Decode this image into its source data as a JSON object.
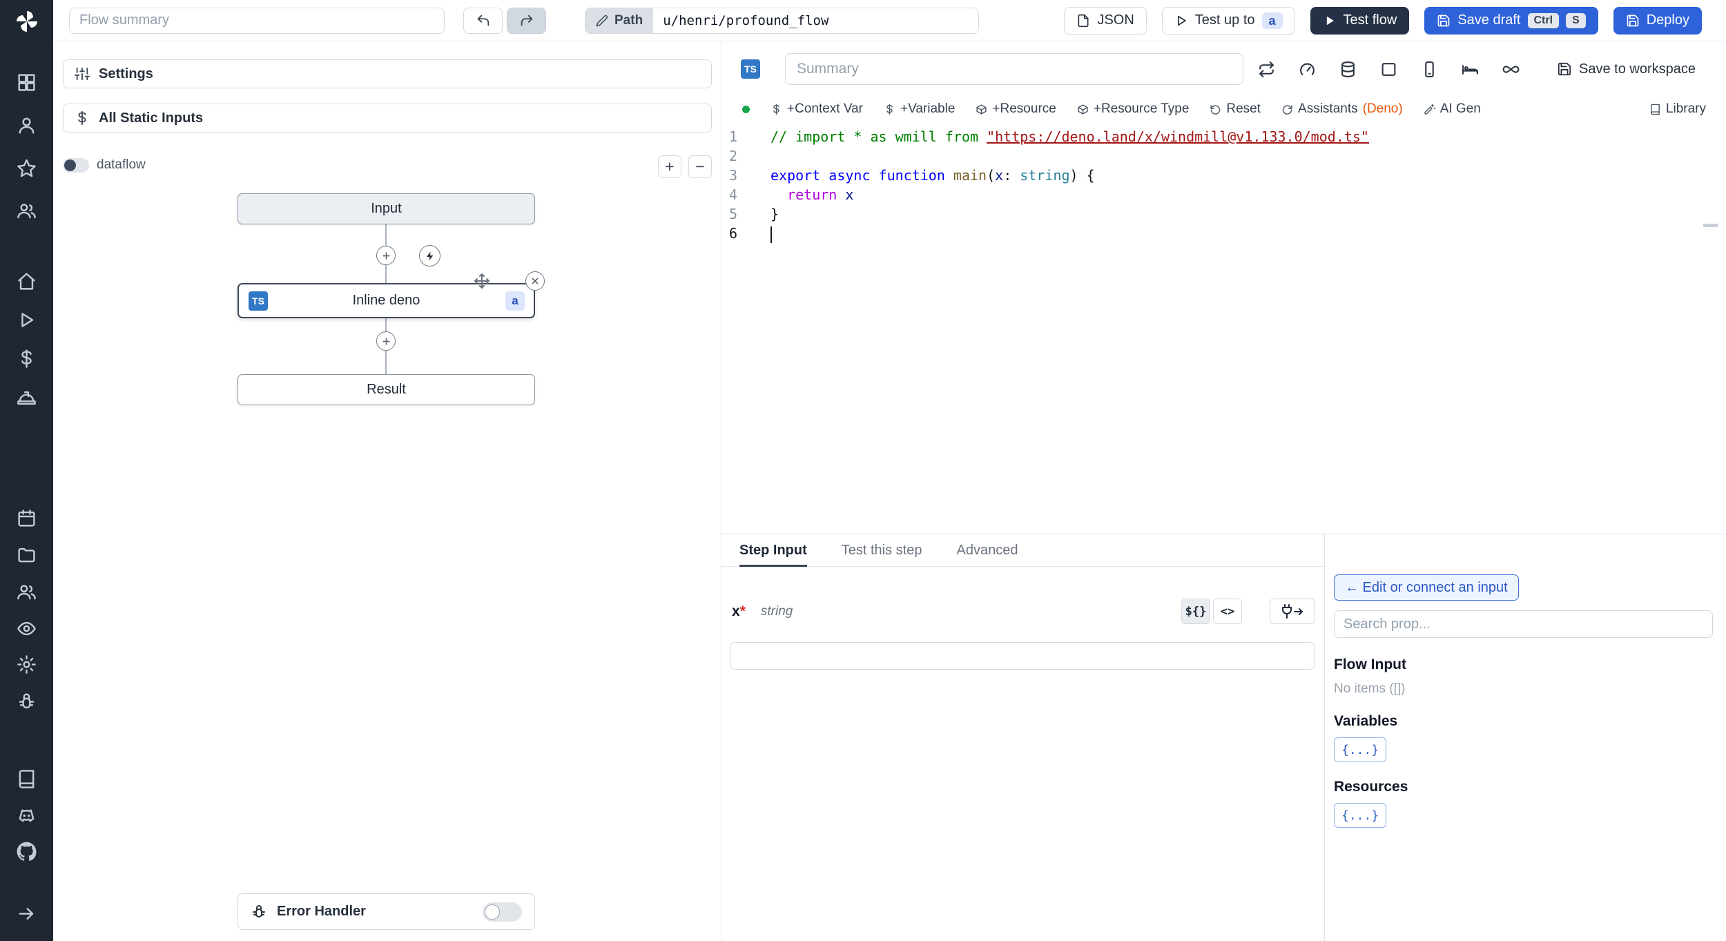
{
  "topbar": {
    "flow_summary_placeholder": "Flow summary",
    "path_label": "Path",
    "path_value": "u/henri/profound_flow",
    "json_label": "JSON",
    "test_up_to_label": "Test up to",
    "test_up_to_badge": "a",
    "test_flow_label": "Test flow",
    "save_draft_label": "Save draft",
    "save_draft_kbd_1": "Ctrl",
    "save_draft_kbd_2": "S",
    "deploy_label": "Deploy"
  },
  "flow_panel": {
    "settings_label": "Settings",
    "static_inputs_label": "All Static Inputs",
    "dataflow_label": "dataflow",
    "zoom_in_label": "+",
    "zoom_out_label": "−",
    "input_node_label": "Input",
    "step_node_label": "Inline deno",
    "step_lang_badge": "TS",
    "step_id_badge": "a",
    "result_node_label": "Result",
    "error_handler_label": "Error Handler"
  },
  "editor": {
    "lang_badge": "TS",
    "summary_placeholder": "Summary",
    "save_to_workspace_label": "Save to workspace",
    "toolbar": {
      "context_var_label": "+Context Var",
      "variable_label": "+Variable",
      "resource_label": "+Resource",
      "resource_type_label": "+Resource Type",
      "reset_label": "Reset",
      "assistants_label": "Assistants",
      "assistants_lang": "(Deno)",
      "ai_gen_label": "AI Gen",
      "library_label": "Library"
    },
    "code": {
      "line_numbers": [
        "1",
        "2",
        "3",
        "4",
        "5",
        "6"
      ],
      "l1_comment": "// import * as wmill from ",
      "l1_url": "\"https://deno.land/x/windmill@v1.133.0/mod.ts\"",
      "l3_keyword": "export async function",
      "l3_space": " ",
      "l3_function": "main",
      "l3_paren_open": "(",
      "l3_param": "x",
      "l3_colon": ": ",
      "l3_type": "string",
      "l3_close": ") {",
      "l4_indent": "  ",
      "l4_keyword": "return",
      "l4_space": " ",
      "l4_var": "x",
      "l5_brace": "}"
    }
  },
  "bottom": {
    "tabs": [
      {
        "label": "Step Input"
      },
      {
        "label": "Test this step"
      },
      {
        "label": "Advanced"
      }
    ],
    "field_name": "x",
    "field_required": "*",
    "field_type": "string",
    "template_button_label": "${}",
    "code_button_label": "<>"
  },
  "props": {
    "connect_button_label": "← Edit or connect an input",
    "search_placeholder": "Search prop...",
    "flow_input_title": "Flow Input",
    "flow_input_empty": "No items ([])",
    "variables_title": "Variables",
    "variables_button": "{...}",
    "resources_title": "Resources",
    "resources_button": "{...}"
  }
}
